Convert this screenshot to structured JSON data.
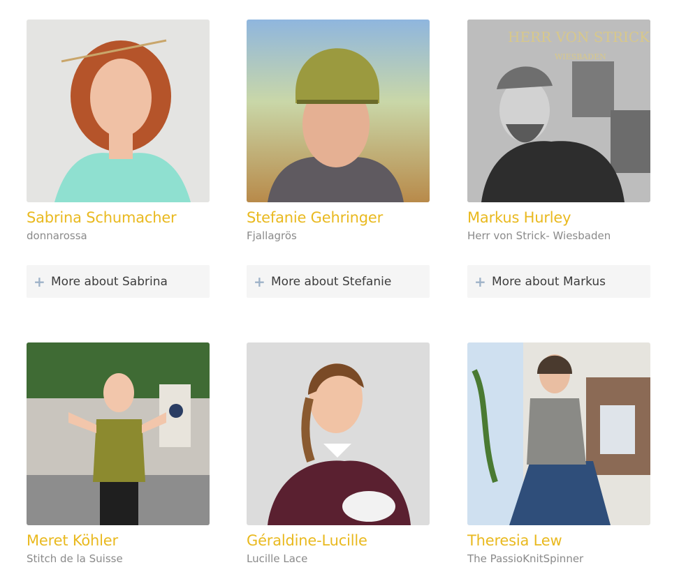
{
  "people": [
    {
      "name": "Sabrina Schumacher",
      "company": "donnarossa",
      "more_label": "More about Sabrina",
      "photo_icon": "portrait-photo"
    },
    {
      "name": "Stefanie Gehringer",
      "company": "Fjallagrös",
      "more_label": "More about Stefanie",
      "photo_icon": "portrait-photo"
    },
    {
      "name": "Markus Hurley",
      "company": "Herr von Strick- Wiesbaden",
      "more_label": "More about Markus",
      "photo_icon": "portrait-photo",
      "photo_sign_line1": "HERR VON STRICK",
      "photo_sign_line2": "WIESBADEN"
    },
    {
      "name": "Meret Köhler",
      "company": "Stitch de la Suisse",
      "photo_icon": "portrait-photo"
    },
    {
      "name": "Géraldine-Lucille",
      "company": "Lucille Lace",
      "photo_icon": "portrait-photo"
    },
    {
      "name": "Theresia Lew",
      "company": "The PassioKnitSpinner",
      "photo_icon": "portrait-photo"
    }
  ],
  "colors": {
    "name": "#e9b91f",
    "company": "#8a8a8a",
    "more_bg": "#f5f5f5",
    "plus": "#9eb2c8"
  },
  "icons": {
    "expand": "plus-icon"
  }
}
